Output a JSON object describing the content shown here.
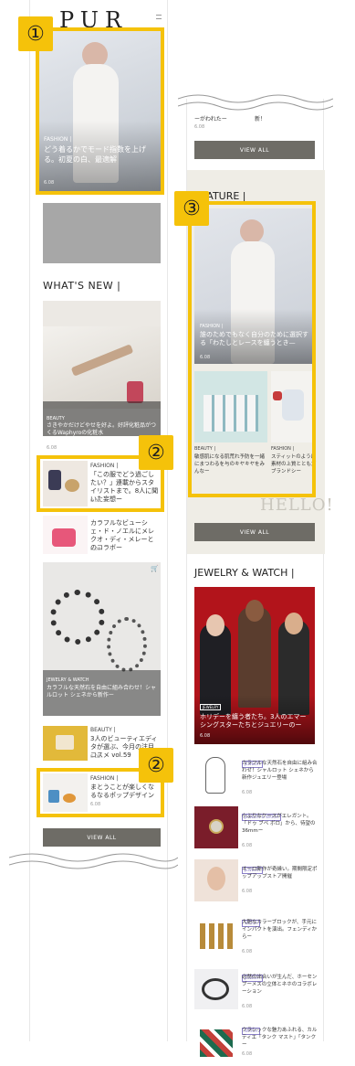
{
  "left": {
    "logo": "PUR JP",
    "hero": {
      "category": "FASHION |",
      "title": "どう着るかでモード指数を上げる。初夏の白、最適解",
      "date": "6.08"
    },
    "whats_new": {
      "heading": "WHAT'S NEW |",
      "big_card": {
        "category": "BEAUTY",
        "title": "さきやかだけどやせを好よ。好評化粧品がつくるWaphyroの化粧水",
        "date": "6.08"
      },
      "items": [
        {
          "category": "FASHION |",
          "title": "「この服でどう過ごしたい？」連載からスタイリストまで。8人に聞いた妄想ー",
          "date": "6.08"
        },
        {
          "category": "",
          "title": "カラフルなビューシェ・ド・ノエルにメレクオ・ディ・メレーとのコラボー",
          "date": "6.08"
        }
      ],
      "jewel_card": {
        "category": "JEWELRY & WATCH",
        "title": "カラフルな天然石を自由に組み合わせ！シャルロット シェネから新作ー",
        "date": "6.08"
      },
      "items2": [
        {
          "category": "BEAUTY |",
          "title": "3人のビューティエディタが選ぶ、今月の注目コスメ vol.59",
          "date": "6.08"
        },
        {
          "category": "FASHION |",
          "title": "まとうことが楽しくなるなるポップデザイン",
          "date": "6.08"
        }
      ],
      "view_all": "VIEW ALL"
    }
  },
  "right": {
    "top_items": [
      {
        "title": "ーがわれたー",
        "date": "6.08"
      },
      {
        "title": "新！",
        "date": ""
      }
    ],
    "view_all_1": "VIEW ALL",
    "feature_heading": "FEATURE |",
    "feature_main": {
      "category": "FASHION |",
      "title": "誰のためでもなく自分のために選択する「わたしとレースを纏うとき—",
      "date": "6.08"
    },
    "feature_small": [
      {
        "category": "BEAUTY |",
        "title": "敏感肌になる肌荒れ予防を一緒にまつわるを与のキヤキヤをみんなー",
        "date": "6.08"
      },
      {
        "category": "FASHION |",
        "title": "スティットのように素材の上質とともだブランドシー",
        "date": "6.08"
      }
    ],
    "hello_text": "HELLO!",
    "view_all_2": "VIEW ALL",
    "jewelry_heading": "JEWELRY & WATCH |",
    "jewelry_card": {
      "tag": "JEWELRY",
      "title": "ホリデーを纏う者たち。3人のエマーシングスターたちとジュエリーのー",
      "date": "6.08"
    },
    "jewelry_items": [
      {
        "tag": "JEWELRY",
        "title": "カラフルな天然石を自由に組み合わせ！シャルロット シェネから新作ジュエリー登場",
        "date": "6.08"
      },
      {
        "tag": "JEWELRY & WATCH",
        "title": "小ぶりなケースがエレガント。「ドゥ ブベ ボロ」から、待望の36mmー",
        "date": "6.08"
      },
      {
        "tag": "JEWELRY",
        "title": "オーロ新作が奇縁い。期間限定ポップアップストア開催",
        "date": "6.08"
      },
      {
        "tag": "WATCH",
        "title": "大胆なカラーブロックが、手元にインパクトを演出。フェンディからー",
        "date": "6.08"
      },
      {
        "tag": "JEWELRY",
        "title": "必然の出合いが生んだ、ホーセンブーメスの立体とネホのコラボレーション",
        "date": "6.08"
      },
      {
        "tag": "WATCH",
        "title": "クラシックな魅力あふれる、カルティエ「タンク マスト」「タンクー",
        "date": "6.08"
      }
    ]
  },
  "badges": {
    "one": "①",
    "two": "②",
    "three": "③"
  },
  "colors": {
    "highlight": "#f5c20a",
    "button": "#6e6c66",
    "beige": "#efede6",
    "tag": "#8a7fc8"
  }
}
